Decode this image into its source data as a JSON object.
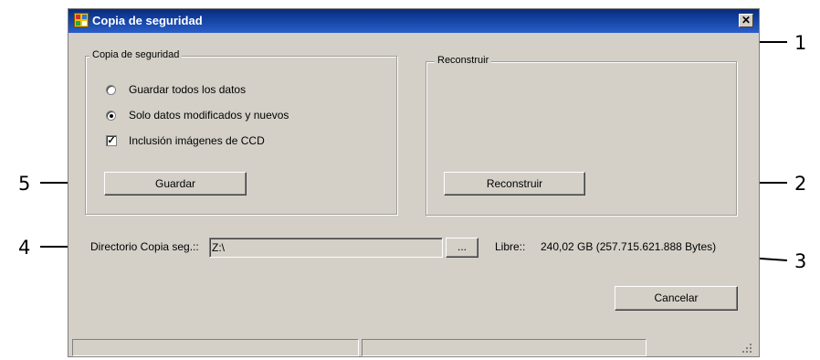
{
  "window": {
    "title": "Copia de seguridad",
    "close_glyph": "✕"
  },
  "backup_group": {
    "legend": "Copia de seguridad",
    "options": [
      {
        "label": "Guardar todos los datos",
        "type": "radio",
        "checked": false
      },
      {
        "label": "Solo datos modificados y nuevos",
        "type": "radio",
        "checked": true
      },
      {
        "label": "Inclusión imágenes de CCD",
        "type": "checkbox",
        "checked": true
      }
    ],
    "save_button": "Guardar"
  },
  "rebuild_group": {
    "legend": "Reconstruir",
    "rebuild_button": "Reconstruir"
  },
  "directory": {
    "label": "Directorio Copia seg.::",
    "value": "Z:\\",
    "browse_button": "...",
    "free_label": "Libre::",
    "free_value": "240,02 GB (257.715.621.888 Bytes)"
  },
  "cancel_button": "Cancelar",
  "callouts": [
    "1",
    "2",
    "3",
    "4",
    "5"
  ],
  "checkbox_glyph": "✓",
  "icons": {
    "app": "app-window-icon",
    "close": "close-icon",
    "grip": "resize-grip-icon"
  }
}
